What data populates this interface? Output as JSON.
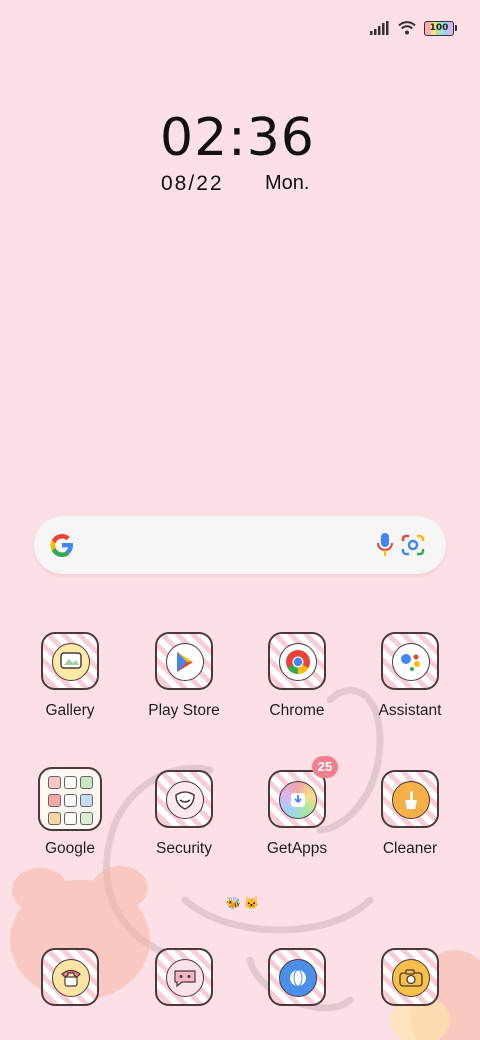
{
  "status": {
    "battery": "100"
  },
  "clock": {
    "time": "02:36",
    "date": "08/22",
    "day": "Mon."
  },
  "search": {
    "logo_letter": "G"
  },
  "apps_row1": [
    {
      "label": "Gallery"
    },
    {
      "label": "Play Store"
    },
    {
      "label": "Chrome"
    },
    {
      "label": "Assistant"
    }
  ],
  "apps_row2": [
    {
      "label": "Google"
    },
    {
      "label": "Security"
    },
    {
      "label": "GetApps",
      "badge": "25"
    },
    {
      "label": "Cleaner"
    }
  ],
  "dock": [
    {
      "icon": "phone-icon"
    },
    {
      "icon": "messages-icon"
    },
    {
      "icon": "browser-icon"
    },
    {
      "icon": "camera-icon"
    }
  ],
  "colors": {
    "background": "#fde0e5",
    "badge": "#f07f90",
    "accent_pink": "#f8cdd5"
  }
}
